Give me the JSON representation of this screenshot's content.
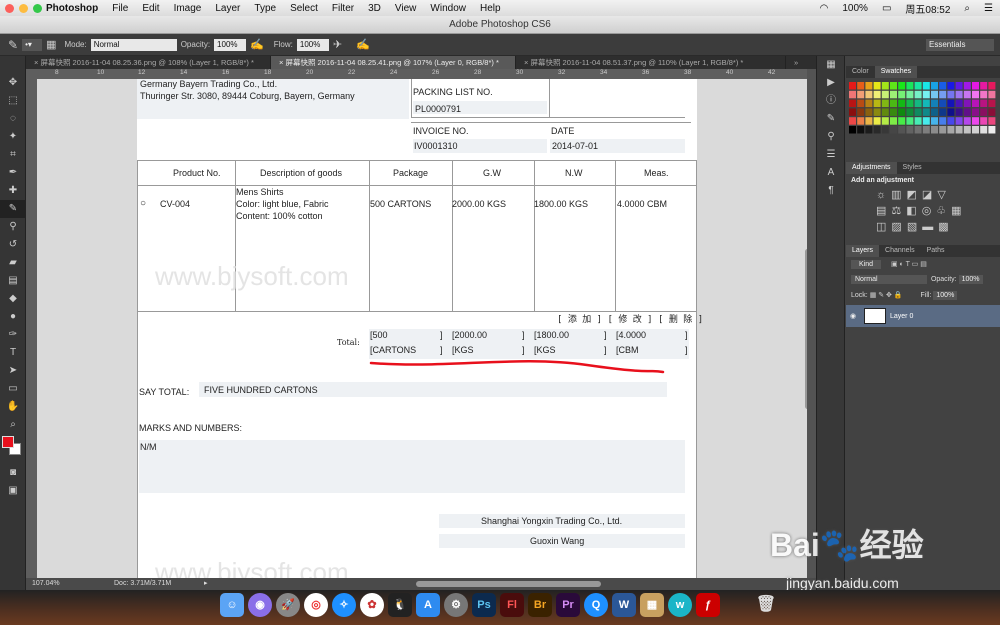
{
  "menubar": {
    "app": "Photoshop",
    "items": [
      "File",
      "Edit",
      "Image",
      "Layer",
      "Type",
      "Select",
      "Filter",
      "3D",
      "View",
      "Window",
      "Help"
    ],
    "battery": "100%",
    "clock": "周五08:52"
  },
  "window": {
    "title": "Adobe Photoshop CS6"
  },
  "options": {
    "mode_label": "Mode:",
    "mode_value": "Normal",
    "opacity_label": "Opacity:",
    "opacity_value": "100%",
    "flow_label": "Flow:",
    "flow_value": "100%",
    "workspace": "Essentials"
  },
  "tabs": [
    "屏幕快照 2016-11-04 08.25.36.png @ 108% (Layer 1, RGB/8*) *",
    "屏幕快照 2016-11-04 08.25.41.png @ 107% (Layer 0, RGB/8*) *",
    "屏幕快照 2016-11-04 08.51.37.png @ 110% (Layer 1, RGB/8*) *"
  ],
  "ruler": [
    "8",
    "10",
    "12",
    "14",
    "16",
    "18",
    "20",
    "22",
    "24",
    "26",
    "28",
    "30",
    "32",
    "34",
    "36",
    "38",
    "40",
    "42"
  ],
  "document": {
    "company_line1": "Germany Bayern Trading Co., Ltd.",
    "company_line2": "Thuringer Str. 3080, 89444 Coburg, Bayern, Germany",
    "packing_label": "PACKING LIST NO.",
    "packing_value": "PL0000791",
    "invoice_label": "INVOICE NO.",
    "invoice_value": "IV0001310",
    "date_label": "DATE",
    "date_value": "2014-07-01",
    "headers": [
      "Product No.",
      "Description of goods",
      "Package",
      "G.W",
      "N.W",
      "Meas."
    ],
    "row": {
      "product": "CV-004",
      "desc1": "Mens Shirts",
      "desc2": "Color: light blue, Fabric",
      "desc3": "Content: 100% cotton",
      "package": "500 CARTONS",
      "gw": "2000.00 KGS",
      "nw": "1800.00 KGS",
      "meas": "4.0000 CBM"
    },
    "watermark": "www.bjysoft.com",
    "actions": "[ 添 加 ] [ 修 改 ] [ 删 除 ]",
    "total_label": "Total:",
    "totals_top": [
      "[500",
      "[2000.00",
      "[1800.00",
      "[4.0000"
    ],
    "totals_bottom": [
      "[CARTONS",
      "[KGS",
      "[KGS",
      "[CBM"
    ],
    "bracket": "]",
    "say_total_label": "SAY TOTAL:",
    "say_total_value": "FIVE HUNDRED CARTONS",
    "marks_label": "MARKS AND NUMBERS:",
    "marks_value": "N/M",
    "sign_company": "Shanghai Yongxin Trading Co., Ltd.",
    "sign_name": "Guoxin Wang"
  },
  "panels": {
    "color_tabs": [
      "Color",
      "Swatches"
    ],
    "adj_tabs": [
      "Adjustments",
      "Styles"
    ],
    "adj_title": "Add an adjustment",
    "layer_tabs": [
      "Layers",
      "Channels",
      "Paths"
    ],
    "kind": "Kind",
    "blend": "Normal",
    "opacity_label": "Opacity:",
    "opacity_value": "100%",
    "lock_label": "Lock:",
    "fill_label": "Fill:",
    "fill_value": "100%",
    "layer_name": "Layer 0"
  },
  "status": {
    "zoom": "107.04%",
    "doc": "Doc: 3.71M/3.71M"
  },
  "baidu": {
    "brand": "Bai",
    "brand2": "经验",
    "url": "jingyan.baidu.com"
  },
  "colors": {
    "annotation": "#e8101c",
    "fg": "#e8101c",
    "bg": "#ffffff"
  }
}
